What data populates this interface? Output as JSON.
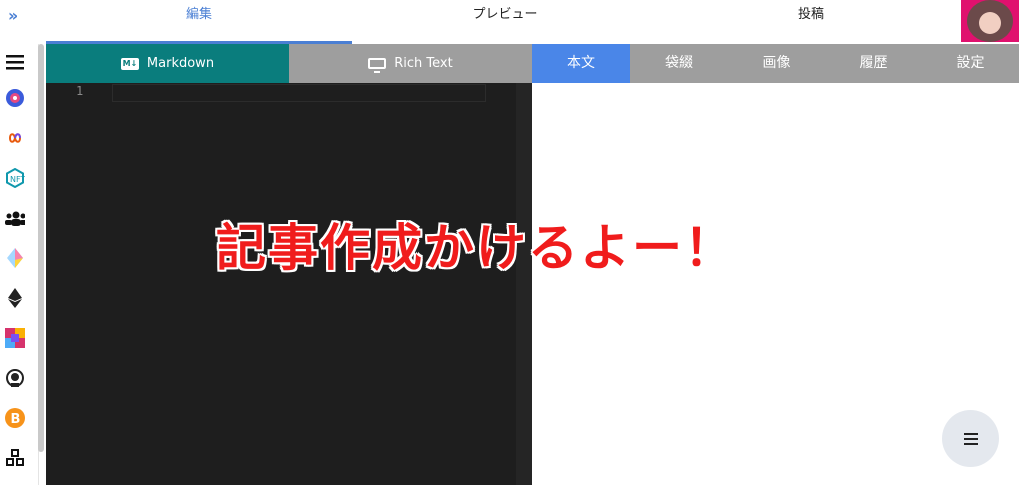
{
  "topnav": {
    "expand_icon": "double-chevron-right-icon",
    "tabs": [
      "編集",
      "プレビュー",
      "投稿"
    ],
    "active_tab": "編集",
    "accent_color": "#4a7fd4"
  },
  "sidebar": {
    "icons": [
      "menu-icon",
      "pie-logo-icon",
      "infinity-icon",
      "nft-icon",
      "users-icon",
      "crystal-icon",
      "ethereum-icon",
      "art-thumbnail-icon",
      "astronaut-icon",
      "bitcoin-icon",
      "cubes-icon"
    ]
  },
  "editor": {
    "mode_markdown": "Markdown",
    "mode_richtext": "Rich Text",
    "line_number": "1",
    "markdown_color": "#0a7d7d"
  },
  "right_tabs": [
    "本文",
    "袋綴",
    "画像",
    "履歴",
    "設定"
  ],
  "active_right_tab": "本文",
  "overlay_text": "記事作成かけるよー！",
  "overlay_color": "#f01c1c",
  "fab_icon": "hamburger-icon"
}
